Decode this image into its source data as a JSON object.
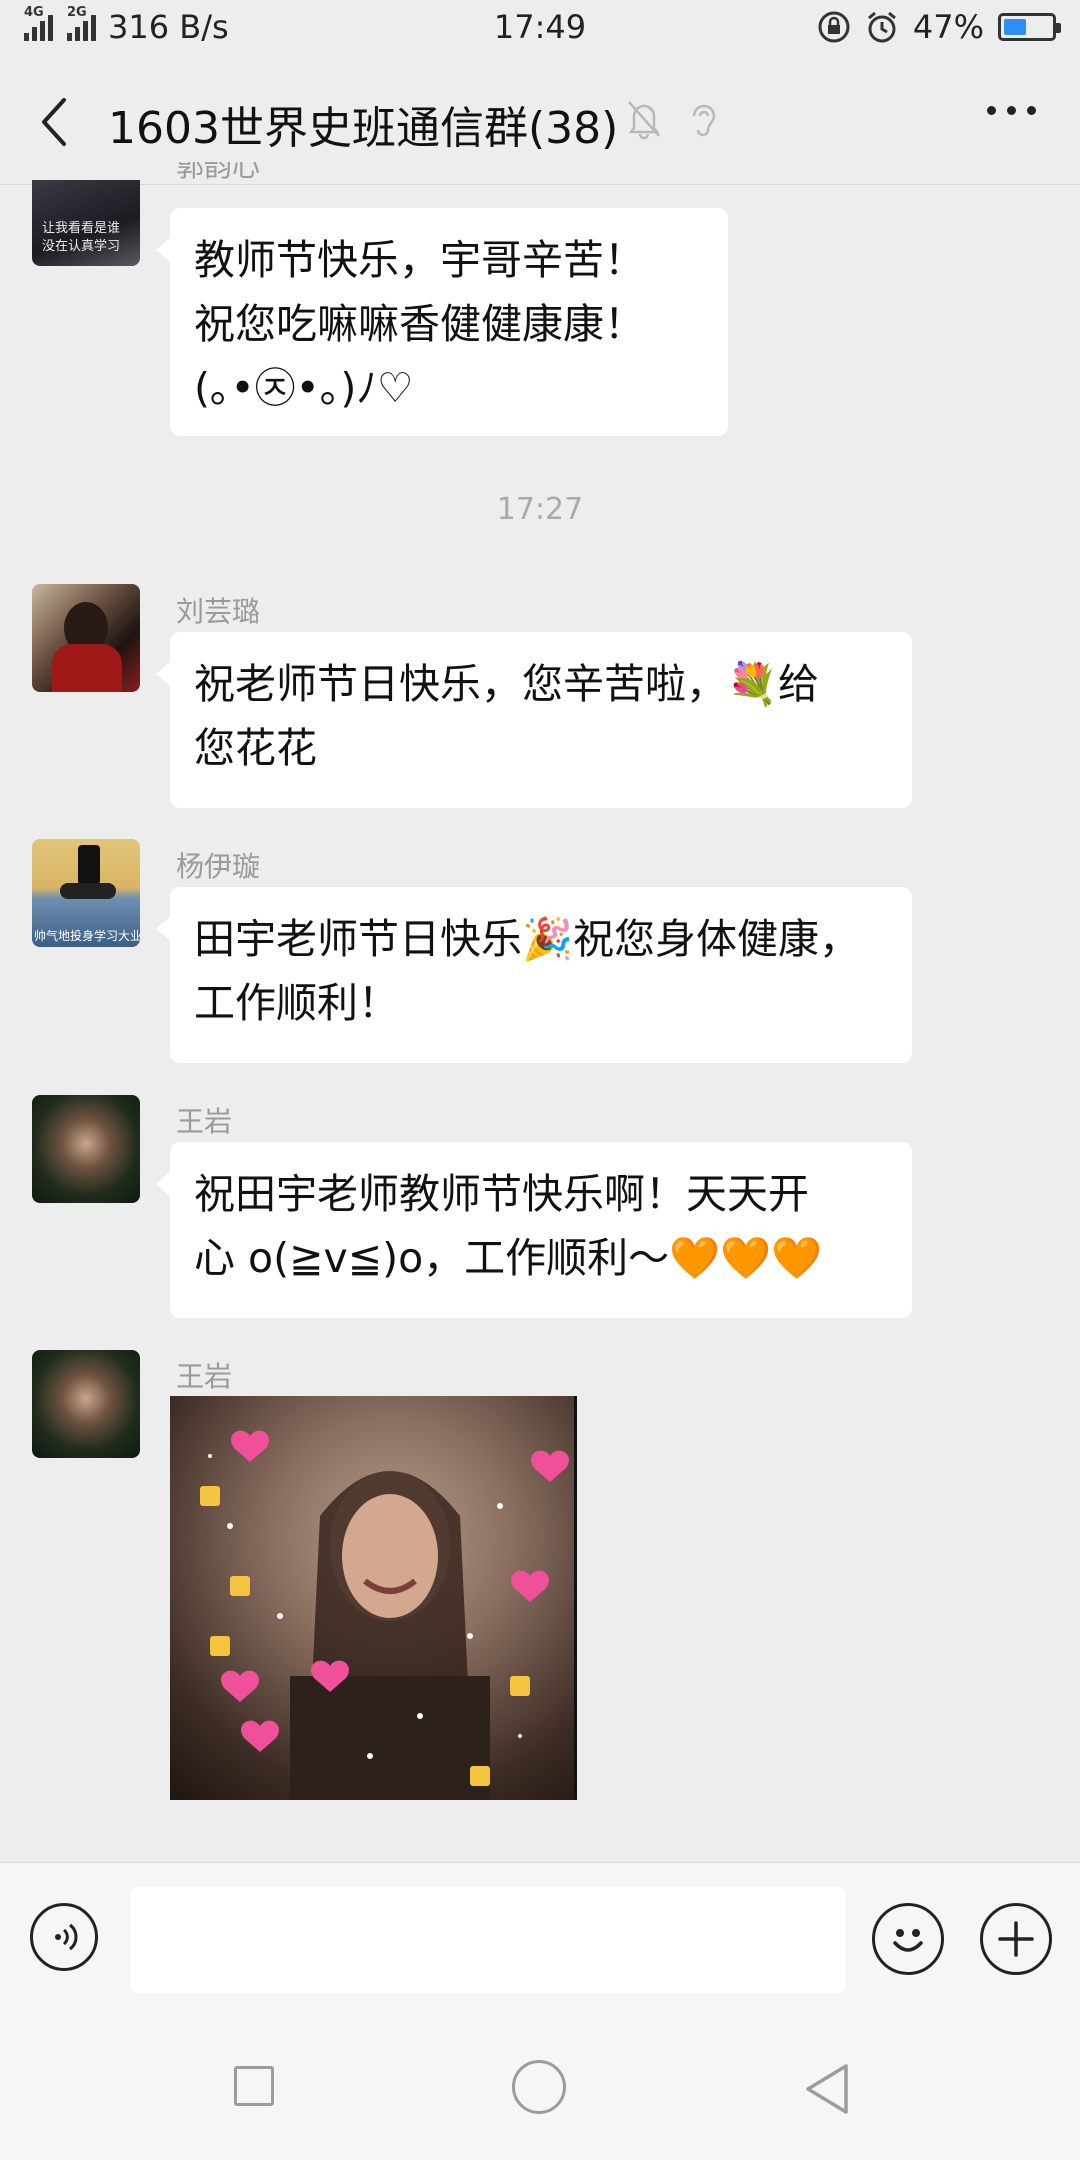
{
  "status_bar": {
    "network_a": "4G",
    "network_b": "2G",
    "speed": "316 B/s",
    "time": "17:49",
    "battery_percent": "47%",
    "battery_level": 0.47
  },
  "header": {
    "title": "1603世界史班通信群(38)"
  },
  "messages": [
    {
      "sender": "郭韵心",
      "avatar_caption_lines": [
        "让我看看是谁",
        "没在认真学习"
      ],
      "text": "教师节快乐，宇哥辛苦！\n祝您吃嘛嘛香健健康康！\n(｡•㉨•｡)ﾉ♡"
    },
    {
      "sender": "刘芸璐",
      "text": "祝老师节日快乐，您辛苦啦，💐给\n您花花"
    },
    {
      "sender": "杨伊璇",
      "avatar_caption": "帅气地投身学习大业",
      "text": "田宇老师节日快乐🎉祝您身体健康，\n工作顺利！"
    },
    {
      "sender": "王岩",
      "text": "祝田宇老师教师节快乐啊！天天开\n心 o(≧v≦)o，工作顺利～🧡🧡🧡"
    },
    {
      "sender": "王岩",
      "type": "image"
    }
  ],
  "timestamp": "17:27",
  "colors": {
    "background": "#ededed",
    "bubble": "#ffffff",
    "battery_fill": "#2f8ef3",
    "heart": "#f0509a"
  },
  "icons": {
    "back": "chevron-left-icon",
    "mute": "bell-off-icon",
    "earpiece": "ear-icon",
    "more": "more-dots-icon",
    "voice": "voice-icon",
    "emoji": "smiley-icon",
    "plus": "plus-icon"
  }
}
